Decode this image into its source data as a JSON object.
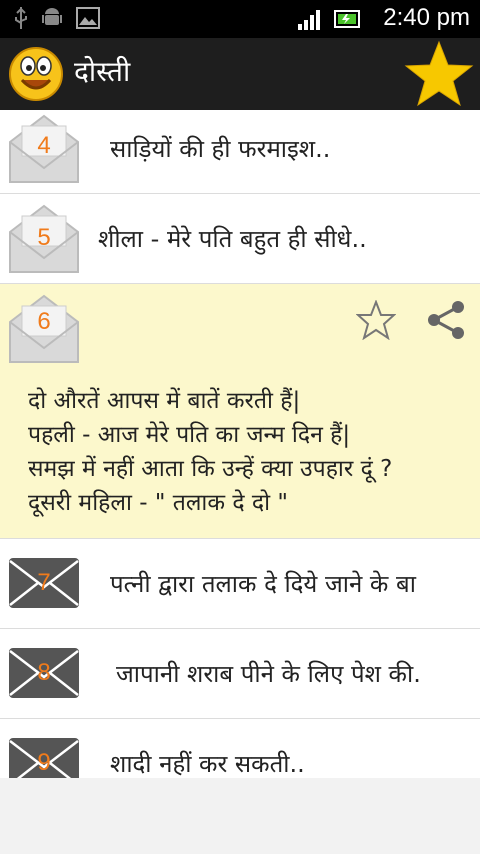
{
  "status_bar": {
    "time": "2:40 pm",
    "icons": [
      "usb-icon",
      "android-icon",
      "image-icon",
      "signal-icon",
      "battery-icon"
    ]
  },
  "app_bar": {
    "title": "दोस्ती",
    "logo_icon": "smiley-icon",
    "favorite_icon": "star-icon",
    "colors": {
      "background": "#1e1e1e",
      "star": "#f7c800"
    }
  },
  "list": {
    "items": [
      {
        "number": "4",
        "title": "साड़ियों की ही फरमाइश..",
        "state": "read"
      },
      {
        "number": "5",
        "title": "शीला - मेरे पति बहुत ही सीधे..",
        "state": "read"
      },
      {
        "number": "6",
        "state": "expanded",
        "body": [
          "दो औरतें आपस में बातें करती हैं|",
          "पहली - आज मेरे पति का जन्म दिन हैं|",
          " समझ में नहीं आता कि उन्हें क्या उपहार दूं ?",
          "दूसरी महिला - \" तलाक दे दो \""
        ]
      },
      {
        "number": "7",
        "title": "पत्नी द्वारा तलाक दे दिये जाने के बा",
        "state": "unread"
      },
      {
        "number": "8",
        "title": "जापानी शराब पीने के लिए पेश की.",
        "state": "unread"
      },
      {
        "number": "9",
        "title": "शादी नहीं कर सकती..",
        "state": "unread"
      }
    ],
    "colors": {
      "number": "#f07b1b",
      "expanded_background": "#fcf8cc"
    }
  }
}
